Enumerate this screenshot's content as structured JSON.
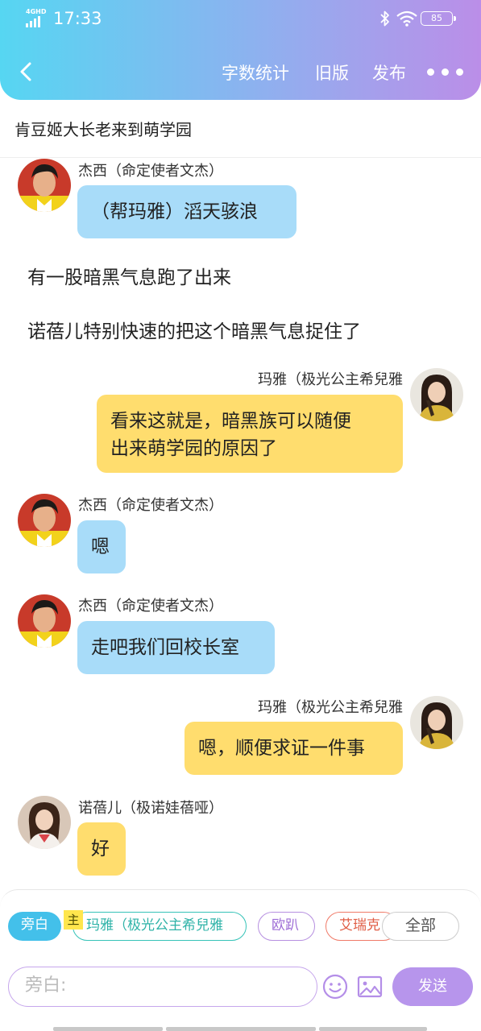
{
  "status_bar": {
    "network": "4GHD",
    "time": "17:33",
    "battery": "85"
  },
  "toolbar": {
    "word_count": "字数统计",
    "old_version": "旧版",
    "publish": "发布"
  },
  "story": {
    "title": "肯豆姬大长老来到萌学园"
  },
  "messages": [
    {
      "speaker": "杰西（命定使者文杰）",
      "text": "（帮玛雅）滔天骇浪"
    },
    {
      "narration": "有一股暗黑气息跑了出来"
    },
    {
      "narration": "诺蓓儿特别快速的把这个暗黑气息捉住了"
    },
    {
      "speaker": "玛雅（极光公主希兒雅",
      "lines": [
        "看来这就是，暗黑族可以随便",
        "出来萌学园的原因了"
      ]
    },
    {
      "speaker": "杰西（命定使者文杰）",
      "text": "嗯"
    },
    {
      "speaker": "杰西（命定使者文杰）",
      "text": "走吧我们回校长室"
    },
    {
      "speaker": "玛雅（极光公主希兒雅",
      "text": "嗯，顺便求证一件事"
    },
    {
      "speaker": "诺蓓儿（极诺娃蓓哑）",
      "text": "好"
    }
  ],
  "role_bar": {
    "narrator": "旁白",
    "main_tag": "主",
    "role_1": "玛雅（极光公主希兒雅",
    "role_2": "欧趴",
    "role_3": "艾瑞克",
    "all": "全部"
  },
  "composer": {
    "placeholder": "旁白:",
    "send": "发送"
  },
  "colors": {
    "header_gradient": [
      "#56d6f2",
      "#bb8ee8"
    ],
    "blue_bubble": "#a8dcf9",
    "yellow_bubble": "#ffdd6e",
    "send_button": "#b795ec"
  }
}
